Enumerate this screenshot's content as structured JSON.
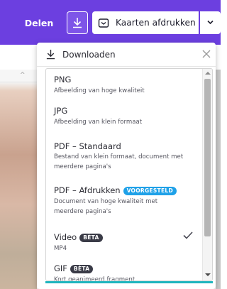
{
  "toolbar": {
    "share_label": "Delen",
    "print_label": "Kaarten afdrukken"
  },
  "panel": {
    "title": "Downloaden"
  },
  "formats": [
    {
      "title": "PNG",
      "description": "Afbeelding van hoge kwaliteit"
    },
    {
      "title": "JPG",
      "description": "Afbeelding van klein formaat"
    },
    {
      "title": "PDF – Standaard",
      "description": "Bestand van klein formaat, document met meerdere pagina's"
    },
    {
      "title": "PDF – Afdrukken",
      "badge": "VOORGESTELD",
      "description": "Document van hoge kwaliteit met meerdere pagina's",
      "selected": true
    },
    {
      "title": "Video",
      "badge": "BÈTA",
      "description": "MP4"
    },
    {
      "title": "GIF",
      "badge": "BÈTA",
      "description": "Kort geanimeerd fragment"
    }
  ],
  "colors": {
    "toolbar": "#6c3fe0",
    "recommended_badge": "#1fa1e8",
    "beta_badge": "#3a3b47",
    "accent_line": "#1fb5be"
  },
  "icons": {
    "download": "download-icon",
    "print": "print-icon",
    "chevron": "chevron-down-icon",
    "close": "close-icon",
    "check": "check-icon"
  }
}
